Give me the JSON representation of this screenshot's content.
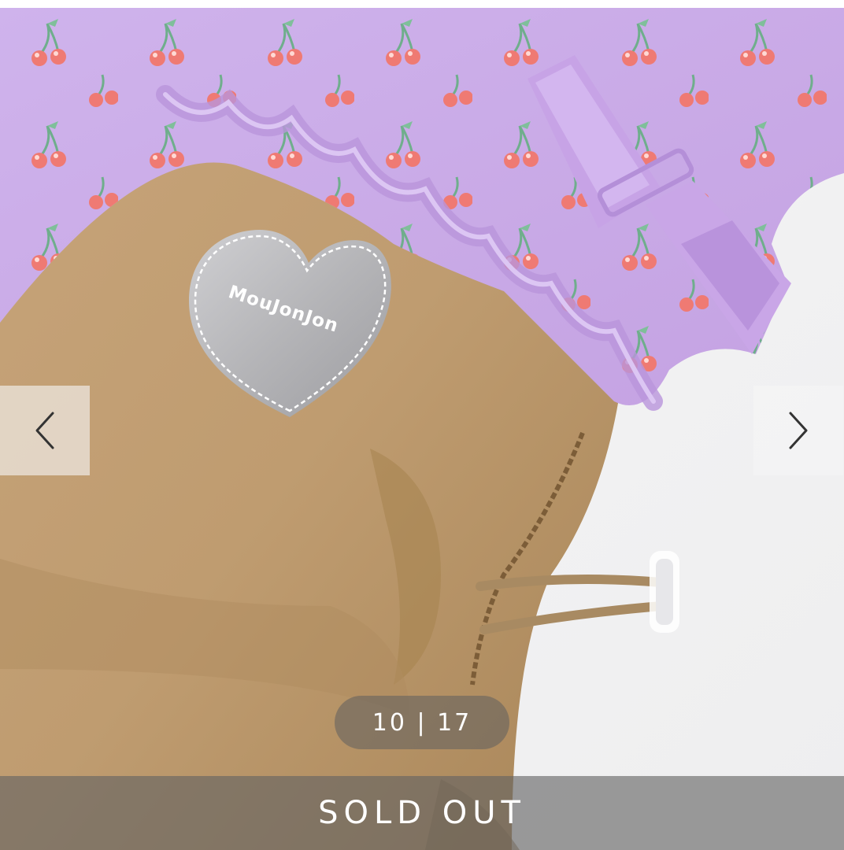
{
  "gallery": {
    "current_index": 10,
    "total": 17,
    "counter_text": "10 | 17",
    "prev_icon": "chevron-left-icon",
    "next_icon": "chevron-right-icon"
  },
  "product": {
    "brand_patch_text": "MouJonJon",
    "status_label": "SOLD OUT"
  },
  "colors": {
    "lavender": "#c9a9e6",
    "khaki": "#c09d71",
    "background": "#f3f3f4"
  }
}
